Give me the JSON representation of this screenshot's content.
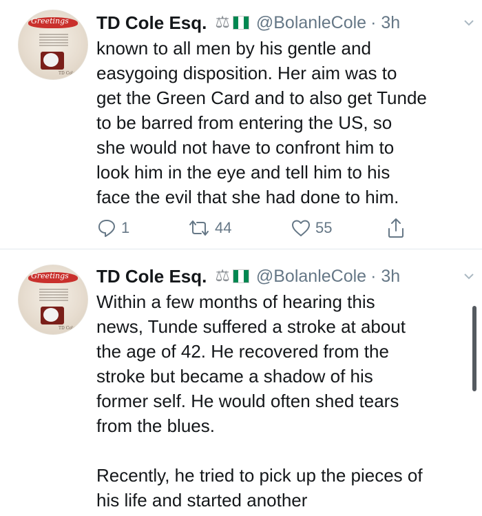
{
  "tweets": [
    {
      "author": {
        "name": "TD Cole Esq.",
        "handle": "@BolanleCole",
        "avatar_greeting": "Greetings",
        "avatar_signature": "TD Cole Esq"
      },
      "time": "· 3h",
      "body_lines": [
        "known to all men by his gentle and",
        "easygoing disposition. Her aim was to",
        "get the Green Card and to also get Tunde",
        "to be barred from entering the US, so",
        "she would not have to confront him to",
        "look him in the eye and tell him to his",
        "face the evil that she had done to him."
      ],
      "actions": {
        "replies": "1",
        "retweets": "44",
        "likes": "55"
      }
    },
    {
      "author": {
        "name": "TD Cole Esq.",
        "handle": "@BolanleCole",
        "avatar_greeting": "Greetings",
        "avatar_signature": "TD Cole Esq"
      },
      "time": "· 3h",
      "body_lines": [
        "Within a few months of hearing this",
        "news, Tunde suffered a stroke at about",
        "the age of 42. He recovered from the",
        "stroke but became a shadow of his",
        "former self. He would often shed tears",
        "from the blues."
      ],
      "body_lines_2": [
        "Recently, he tried to pick up the pieces of",
        "his life and started another"
      ]
    }
  ],
  "icons": {
    "verified_badges": [
      "scales-icon",
      "nigeria-flag-icon"
    ],
    "action_icons": [
      "reply-icon",
      "retweet-icon",
      "like-icon",
      "share-icon"
    ],
    "menu": "chevron-down-icon"
  },
  "colors": {
    "text": "#14171a",
    "secondary": "#657786",
    "divider": "#e1e8ed",
    "flag_green": "#008751",
    "avatar_accent": "#c9302c"
  }
}
